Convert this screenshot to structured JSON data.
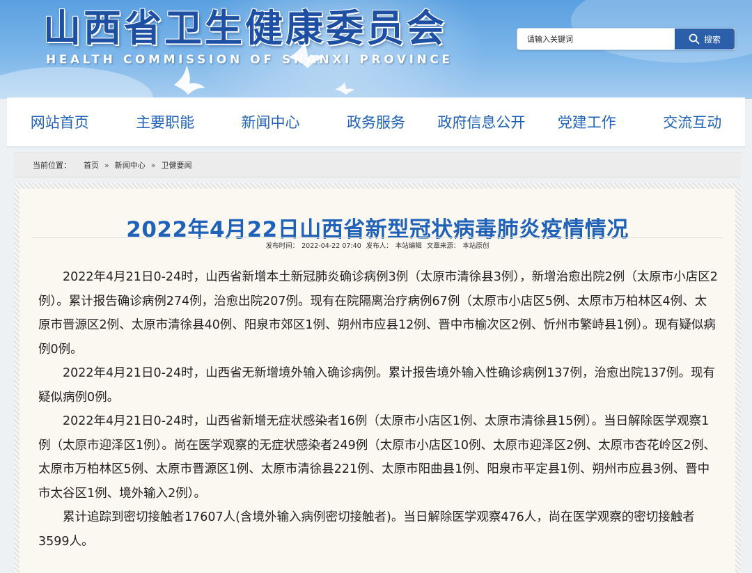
{
  "header": {
    "title": "山西省卫生健康委员会",
    "subtitle": "HEALTH COMMISSION OF SHANXI PROVINCE",
    "search": {
      "placeholder": "请输入关键词",
      "button_label": "搜索"
    }
  },
  "nav": {
    "items": [
      {
        "label": "网站首页"
      },
      {
        "label": "主要职能"
      },
      {
        "label": "新闻中心"
      },
      {
        "label": "政务服务"
      },
      {
        "label": "政府信息公开"
      },
      {
        "label": "党建工作"
      },
      {
        "label": "交流互动"
      }
    ]
  },
  "breadcrumb": {
    "label": "当前位置：",
    "items": [
      "首页",
      "新闻中心",
      "卫健要闻"
    ],
    "separator": "»"
  },
  "article": {
    "title": "2022年4月22日山西省新型冠状病毒肺炎疫情情况",
    "meta": {
      "publish_label": "发布时间：",
      "publish_time": "2022-04-22 07:40",
      "publisher_label": "发布人：",
      "publisher": "本站编辑",
      "source_label": "文章来源：",
      "source": "本站原创"
    },
    "paragraphs": [
      "2022年4月21日0-24时，山西省新增本土新冠肺炎确诊病例3例（太原市清徐县3例），新增治愈出院2例（太原市小店区2例）。累计报告确诊病例274例，治愈出院207例。现有在院隔离治疗病例67例（太原市小店区5例、太原市万柏林区4例、太原市晋源区2例、太原市清徐县40例、阳泉市郊区1例、朔州市应县12例、晋中市榆次区2例、忻州市繁峙县1例）。现有疑似病例0例。",
      "2022年4月21日0-24时，山西省无新增境外输入确诊病例。累计报告境外输入性确诊病例137例，治愈出院137例。现有疑似病例0例。",
      "2022年4月21日0-24时，山西省新增无症状感染者16例（太原市小店区1例、太原市清徐县15例）。当日解除医学观察1例（太原市迎泽区1例）。尚在医学观察的无症状感染者249例（太原市小店区10例、太原市迎泽区2例、太原市杏花岭区2例、太原市万柏林区5例、太原市晋源区1例、太原市清徐县221例、太原市阳曲县1例、阳泉市平定县1例、朔州市应县3例、晋中市太谷区1例、境外输入2例）。",
      "累计追踪到密切接触者17607人(含境外输入病例密切接触者)。当日解除医学观察476人，尚在医学观察的密切接触者3599人。"
    ]
  },
  "colors": {
    "brand_blue": "#1f62b8",
    "search_button": "#2c5fa9",
    "banner_sky": "#5aa0e0"
  },
  "icons": [
    "search-icon",
    "dove-icon"
  ]
}
